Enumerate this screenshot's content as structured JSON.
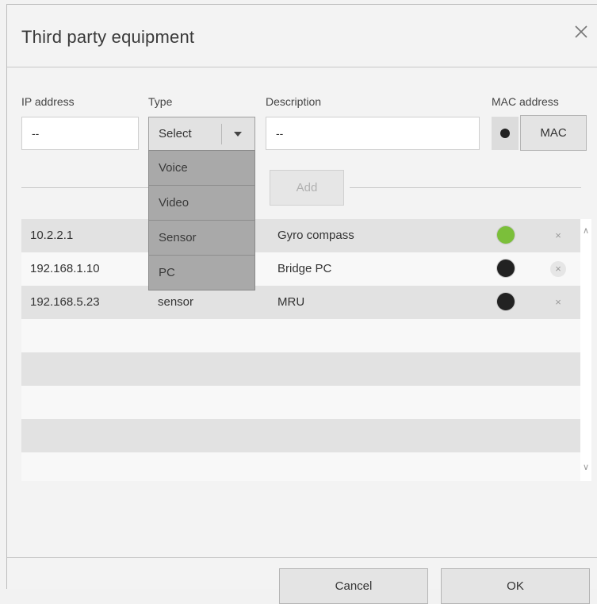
{
  "dialog": {
    "title": "Third party equipment",
    "close_icon": "close-icon"
  },
  "form": {
    "ip_label": "IP address",
    "ip_value": "--",
    "type_label": "Type",
    "type_selected": "Select",
    "type_options": [
      "Voice",
      "Video",
      "Sensor",
      "PC"
    ],
    "description_label": "Description",
    "description_value": "--",
    "mac_label": "MAC address",
    "mac_button": "MAC",
    "add_button": "Add"
  },
  "table": {
    "rows": [
      {
        "ip": "10.2.2.1",
        "type": "",
        "description": "Gyro compass",
        "status": "online",
        "status_color": "#7bbf3a"
      },
      {
        "ip": "192.168.1.10",
        "type": "",
        "description": "Bridge PC",
        "status": "offline",
        "status_color": "#222222"
      },
      {
        "ip": "192.168.5.23",
        "type": "sensor",
        "description": "MRU",
        "status": "offline",
        "status_color": "#222222"
      }
    ],
    "remove_symbol": "×"
  },
  "footer": {
    "cancel": "Cancel",
    "ok": "OK"
  },
  "colors": {
    "online": "#7bbf3a",
    "offline": "#222222"
  }
}
